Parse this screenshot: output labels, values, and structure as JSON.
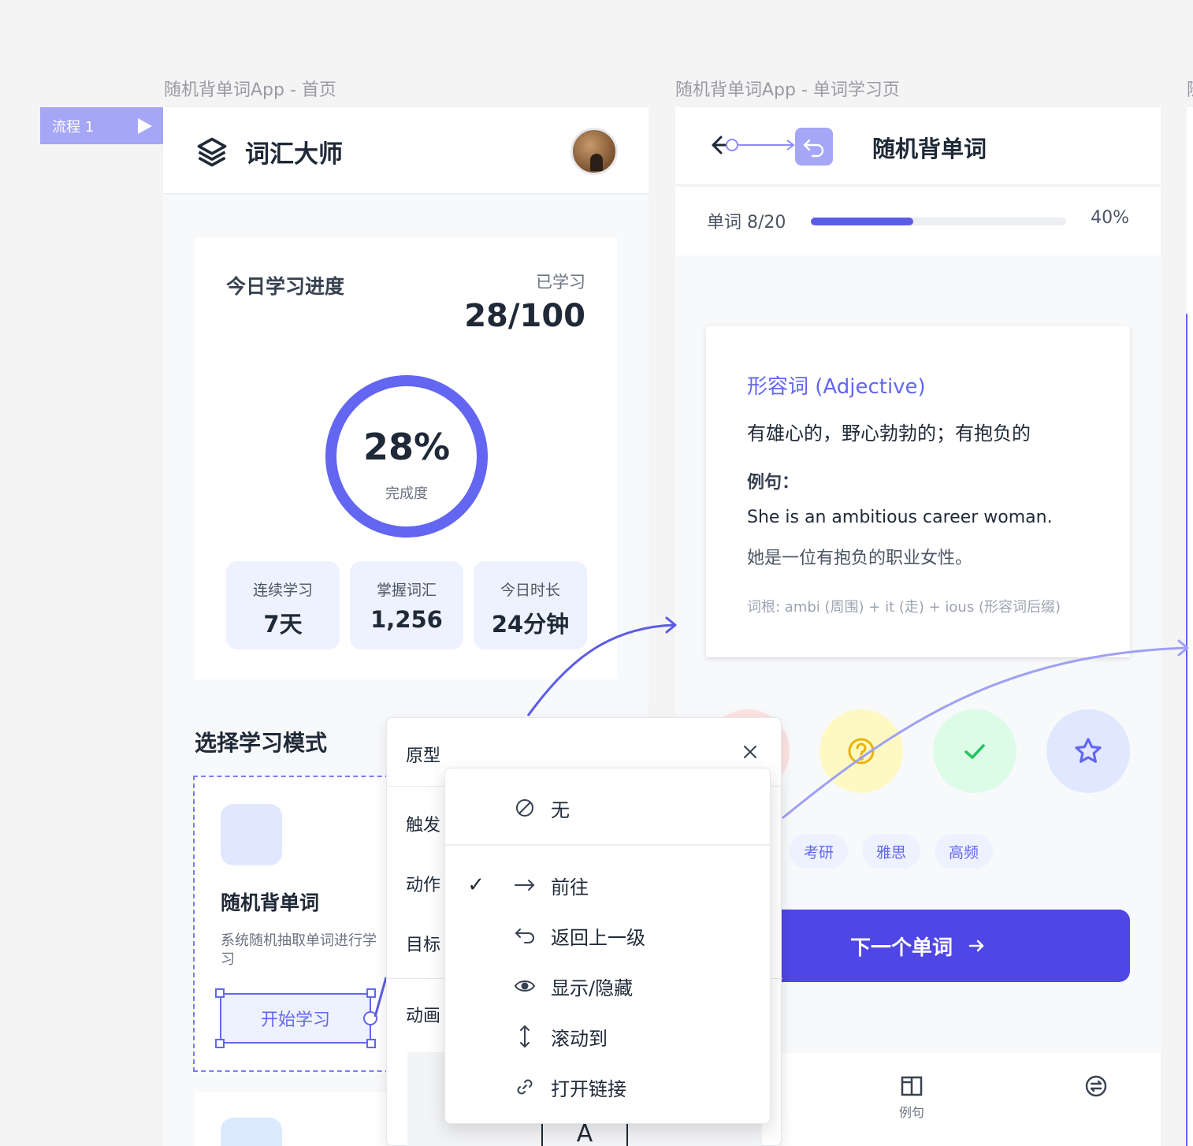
{
  "canvas": {
    "frame_home_label": "随机背单词App - 首页",
    "frame_study_label": "随机背单词App - 单词学习页",
    "frame_third_label": "随",
    "flow_tag": "流程 1"
  },
  "home": {
    "brand_name": "词汇大师",
    "progress": {
      "title": "今日学习进度",
      "learned_label": "已学习",
      "learned_value": "28/100",
      "percent_text": "28%",
      "percent_value": 0.28,
      "percent_sub": "完成度"
    },
    "stats": [
      {
        "label": "连续学习",
        "value": "7天"
      },
      {
        "label": "掌握词汇",
        "value": "1,256"
      },
      {
        "label": "今日时长",
        "value": "24分钟"
      }
    ],
    "mode_section_title": "选择学习模式",
    "mode_card": {
      "name": "随机背单词",
      "desc": "系统随机抽取单词进行学习",
      "start_button": "开始学习"
    }
  },
  "study": {
    "title": "随机背单词",
    "progress_label": "单词 8/20",
    "progress_fraction": 0.4,
    "progress_pct": "40%",
    "word_card": {
      "pos": "形容词 (Adjective)",
      "meaning": "有雄心的，野心勃勃的；有抱负的",
      "example_label": "例句：",
      "example_en": "She is an ambitious career woman.",
      "example_zh": "她是一位有抱负的职业女性。",
      "root": "词根: ambi (周围) + it (走) + ious (形容词后缀)"
    },
    "tags": [
      "考研",
      "雅思",
      "高频"
    ],
    "next_button": "下一个单词",
    "bottom_nav": [
      {
        "label": "例句",
        "icon": "book-icon"
      },
      {
        "label": "",
        "icon": "swap-icon"
      }
    ],
    "colors": {
      "accent": "#4f46e5",
      "light_accent": "#eef2ff"
    }
  },
  "prototype_panel": {
    "title": "原型",
    "rows": [
      "触发",
      "动作",
      "目标",
      "动画"
    ],
    "preview_letter": "A"
  },
  "action_dropdown": {
    "options": [
      {
        "label": "无",
        "icon": "none-icon",
        "checked": false
      },
      {
        "label": "前往",
        "icon": "arrow-right-icon",
        "checked": true
      },
      {
        "label": "返回上一级",
        "icon": "back-icon",
        "checked": false
      },
      {
        "label": "显示/隐藏",
        "icon": "eye-icon",
        "checked": false
      },
      {
        "label": "滚动到",
        "icon": "scroll-icon",
        "checked": false
      },
      {
        "label": "打开链接",
        "icon": "link-icon",
        "checked": false
      }
    ]
  }
}
